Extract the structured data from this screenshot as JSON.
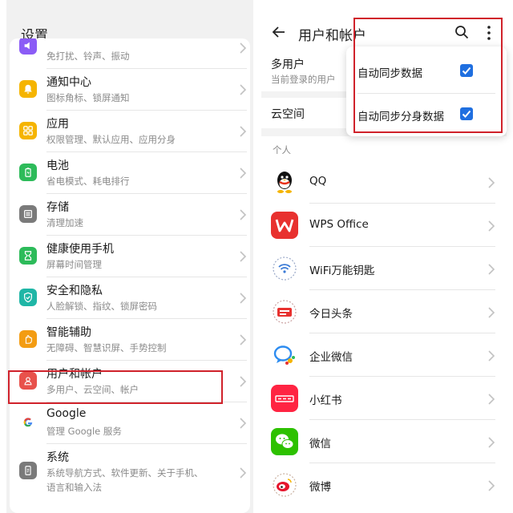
{
  "left_panel": {
    "header_title": "设置",
    "items": [
      {
        "title": "",
        "subtitle": "免打扰、铃声、振动",
        "icon": "sound-icon",
        "color": "#8b5cf6"
      },
      {
        "title": "通知中心",
        "subtitle": "图标角标、锁屏通知",
        "icon": "bell-icon",
        "color": "#f5b400"
      },
      {
        "title": "应用",
        "subtitle": "权限管理、默认应用、应用分身",
        "icon": "apps-grid-icon",
        "color": "#f5b400"
      },
      {
        "title": "电池",
        "subtitle": "省电模式、耗电排行",
        "icon": "battery-icon",
        "color": "#2dbb5a"
      },
      {
        "title": "存储",
        "subtitle": "清理加速",
        "icon": "storage-icon",
        "color": "#7a7a7a"
      },
      {
        "title": "健康使用手机",
        "subtitle": "屏幕时间管理",
        "icon": "hourglass-icon",
        "color": "#2dbb5a"
      },
      {
        "title": "安全和隐私",
        "subtitle": "人脸解锁、指纹、锁屏密码",
        "icon": "shield-icon",
        "color": "#1fb6a6"
      },
      {
        "title": "智能辅助",
        "subtitle": "无障碍、智慧识屏、手势控制",
        "icon": "hand-icon",
        "color": "#f39c12"
      },
      {
        "title": "用户和帐户",
        "subtitle": "多用户、云空间、帐户",
        "icon": "user-icon",
        "color": "#e8514b"
      },
      {
        "title": "Google",
        "subtitle": "管理 Google 服务",
        "icon": "google-icon",
        "color": "#ffffff"
      },
      {
        "title": "系统",
        "subtitle": "系统导航方式、软件更新、关于手机、",
        "subtitle2": "语言和输入法",
        "icon": "phone-icon",
        "color": "#7a7a7a"
      }
    ]
  },
  "right_panel": {
    "title": "用户和帐户",
    "multi_user_title": "多用户",
    "multi_user_sub": "当前登录的用户",
    "cloud_space": "云空间",
    "section_label": "个人",
    "apps": [
      {
        "name": "QQ",
        "icon": "qq-icon"
      },
      {
        "name": "WPS Office",
        "icon": "wps-icon"
      },
      {
        "name": "WiFi万能钥匙",
        "icon": "wifi-key-icon"
      },
      {
        "name": "今日头条",
        "icon": "toutiao-icon"
      },
      {
        "name": "企业微信",
        "icon": "wecom-icon"
      },
      {
        "name": "小红书",
        "icon": "xiaohongshu-icon"
      },
      {
        "name": "微信",
        "icon": "wechat-icon"
      },
      {
        "name": "微博",
        "icon": "weibo-icon"
      }
    ],
    "popup_menu": [
      {
        "label": "自动同步数据",
        "checked": true
      },
      {
        "label": "自动同步分身数据",
        "checked": true
      }
    ]
  },
  "colors": {
    "highlight_red": "#d0222b",
    "checkbox_blue": "#1f6fe0"
  }
}
